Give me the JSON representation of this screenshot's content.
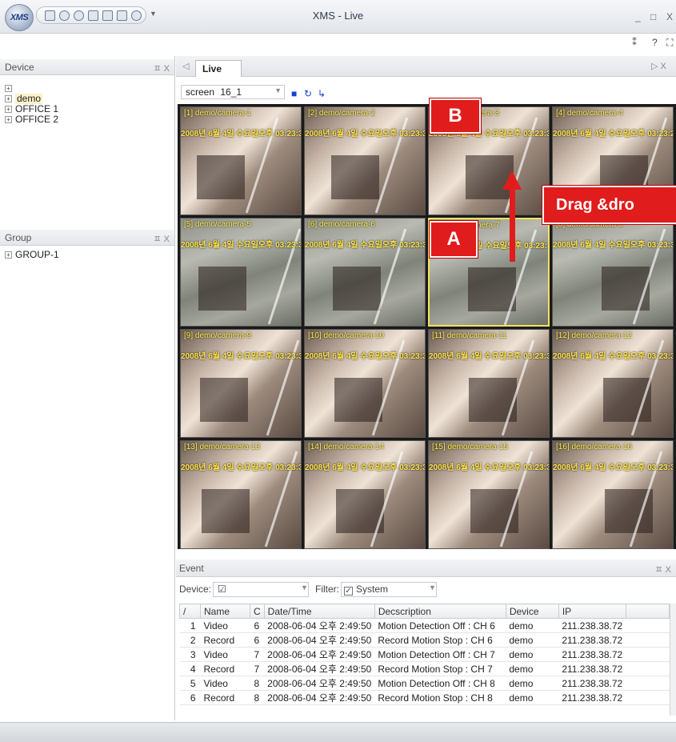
{
  "window": {
    "title": "XMS - Live",
    "logo_text": "XMS",
    "minimize": "_",
    "maximize": "□",
    "close": "X",
    "help_label": "?"
  },
  "device_panel": {
    "title": "Device",
    "pin": "ㅍ X",
    "items": [
      {
        "label": ""
      },
      {
        "label": "demo"
      },
      {
        "label": "OFFICE 1"
      },
      {
        "label": "OFFICE 2"
      }
    ]
  },
  "group_panel": {
    "title": "Group",
    "pin": "ㅍ X",
    "items": [
      {
        "label": "GROUP-1"
      }
    ]
  },
  "tabs": {
    "active": "Live",
    "nav_left": "◁",
    "nav_right": "▷ X"
  },
  "screen_toolbar": {
    "label": "screen",
    "value": "16_1"
  },
  "cameras": [
    {
      "label": "[1]   demo/camera-1",
      "timestamp": "2008년 6월 4일 수요일오후 03:23:34",
      "scene": "warm",
      "selected": false
    },
    {
      "label": "[2]   demo/camera-2",
      "timestamp": "2008년 6월 4일 수요일오후 03:23:31",
      "scene": "warm",
      "selected": false
    },
    {
      "label": "[3]   demo/camera-3",
      "timestamp": "2008년 6월 4일 수요일오후 03:23:33",
      "scene": "warm",
      "selected": false
    },
    {
      "label": "[4]   demo/camera-4",
      "timestamp": "2008년 6월 4일 수요일오후 03:23:29",
      "scene": "warm",
      "selected": false
    },
    {
      "label": "[5]   demo/camera-5",
      "timestamp": "2008년 6월 4일 수요일오후 03:23:31",
      "scene": "gray",
      "selected": false
    },
    {
      "label": "[6]   demo/camera-6",
      "timestamp": "2008년 6월 4일 수요일오후 03:23:32",
      "scene": "gray",
      "selected": false
    },
    {
      "label": "[7]   demo/camera-7",
      "timestamp": "2008년 6월 4일 수요일오후 03:23:32",
      "scene": "gray",
      "selected": true
    },
    {
      "label": "[8]   demo/camera-8",
      "timestamp": "2008년 6월 4일 수요일오후 03:23:32",
      "scene": "gray",
      "selected": false
    },
    {
      "label": "[9]   demo/camera-9",
      "timestamp": "2008년 6월 4일 수요일오후 03:23:34",
      "scene": "warm",
      "selected": false
    },
    {
      "label": "[10]  demo/camera-10",
      "timestamp": "2008년 6월 4일 수요일오후 03:23:33",
      "scene": "warm",
      "selected": false
    },
    {
      "label": "[11]  demo/camera-11",
      "timestamp": "2008년 6월 4일 수요일오후 03:23:34",
      "scene": "warm",
      "selected": false
    },
    {
      "label": "[12]  demo/camera-12",
      "timestamp": "2008년 6월 4일 수요일오후 03:23:32",
      "scene": "warm",
      "selected": false
    },
    {
      "label": "[13]  demo/camera-13",
      "timestamp": "2008년 6월 4일 수요일오후 03:23:34",
      "scene": "warm",
      "selected": false
    },
    {
      "label": "[14]  demo/camera-14",
      "timestamp": "2008년 6월 4일 수요일오후 03:23:34",
      "scene": "warm",
      "selected": false
    },
    {
      "label": "[15]  demo/camera-15",
      "timestamp": "2008년 6월 4일 수요일오후 03:23:33",
      "scene": "warm",
      "selected": false
    },
    {
      "label": "[16]  demo/camera-16",
      "timestamp": "2008년 6월 4일 수요일오후 03:23:33",
      "scene": "warm",
      "selected": false
    }
  ],
  "annotations": {
    "callout_a": "A",
    "callout_b": "B",
    "drag_label": "Drag &dro",
    "color": "#e11c1c"
  },
  "event_panel": {
    "title": "Event",
    "pin": "ㅍ X",
    "device_label": "Device:",
    "device_checked": "☑",
    "filter_label": "Filter:",
    "filter_value": "System",
    "columns": [
      "/",
      "Name",
      "C",
      "Date/Time",
      "Decscription",
      "Device",
      "IP"
    ],
    "rows": [
      {
        "n": "1",
        "name": "Video",
        "c": "6",
        "datetime": "2008-06-04 오후 2:49:50",
        "desc": "Motion Detection Off : CH 6",
        "device": "demo",
        "ip": "211.238.38.72"
      },
      {
        "n": "2",
        "name": "Record",
        "c": "6",
        "datetime": "2008-06-04 오후 2:49:50",
        "desc": "Record Motion Stop    : CH 6",
        "device": "demo",
        "ip": "211.238.38.72"
      },
      {
        "n": "3",
        "name": "Video",
        "c": "7",
        "datetime": "2008-06-04 오후 2:49:50",
        "desc": "Motion Detection Off : CH 7",
        "device": "demo",
        "ip": "211.238.38.72"
      },
      {
        "n": "4",
        "name": "Record",
        "c": "7",
        "datetime": "2008-06-04 오후 2:49:50",
        "desc": "Record Motion Stop    : CH 7",
        "device": "demo",
        "ip": "211.238.38.72"
      },
      {
        "n": "5",
        "name": "Video",
        "c": "8",
        "datetime": "2008-06-04 오후 2:49:50",
        "desc": "Motion Detection Off : CH 8",
        "device": "demo",
        "ip": "211.238.38.72"
      },
      {
        "n": "6",
        "name": "Record",
        "c": "8",
        "datetime": "2008-06-04 오후 2:49:50",
        "desc": "Record Motion Stop    : CH 8",
        "device": "demo",
        "ip": "211.238.38.72"
      }
    ]
  }
}
